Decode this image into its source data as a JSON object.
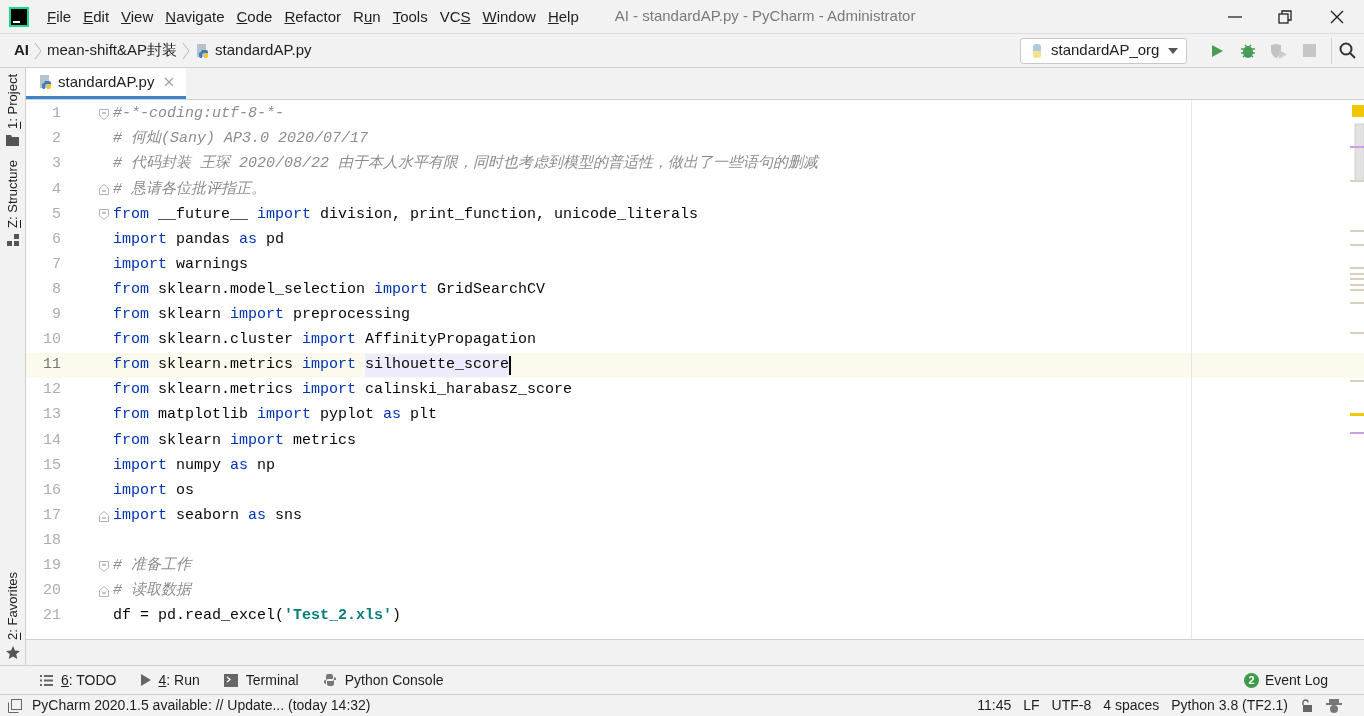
{
  "window": {
    "title": "AI - standardAP.py - PyCharm - Administrator"
  },
  "menu": [
    {
      "key": "F",
      "after": "ile"
    },
    {
      "key": "E",
      "after": "dit"
    },
    {
      "key": "V",
      "after": "iew"
    },
    {
      "key": "N",
      "after": "avigate"
    },
    {
      "key": "C",
      "after": "ode"
    },
    {
      "key": "R",
      "after": "efactor"
    },
    {
      "before": "R",
      "key": "u",
      "after": "n"
    },
    {
      "key": "T",
      "after": "ools"
    },
    {
      "before": "VC",
      "key": "S"
    },
    {
      "key": "W",
      "after": "indow"
    },
    {
      "key": "H",
      "after": "elp"
    }
  ],
  "breadcrumbs": [
    {
      "label": "AI",
      "kind": "project"
    },
    {
      "label": "mean-shift&AP封装",
      "kind": "folder"
    },
    {
      "label": "standardAP.py",
      "kind": "file"
    }
  ],
  "run_config": {
    "label": "standardAP_org"
  },
  "toolbar": [
    {
      "kind": "run",
      "disabled": false
    },
    {
      "kind": "debug",
      "disabled": false
    },
    {
      "kind": "coverage",
      "disabled": true
    },
    {
      "kind": "stop",
      "disabled": true
    },
    {
      "kind": "search",
      "disabled": false
    }
  ],
  "left_tools": [
    {
      "key": "1",
      "after": ": Project",
      "kind": "project"
    },
    {
      "key": "Z",
      "after": ": Structure",
      "kind": "structure"
    },
    {
      "key": "2",
      "after": ": Favorites",
      "kind": "favorites"
    }
  ],
  "tabs": [
    {
      "label": "standardAP.py",
      "selected": true
    }
  ],
  "code_lines": [
    {
      "number": "1",
      "fold_open": true,
      "current": false,
      "segments": [
        {
          "kind": "comment",
          "text": "#-*-coding:utf-8-*-"
        }
      ]
    },
    {
      "number": "2",
      "current": false,
      "segments": [
        {
          "kind": "comment",
          "text": "# 何灿(Sany) AP3.0 2020/07/17"
        }
      ]
    },
    {
      "number": "3",
      "current": false,
      "segments": [
        {
          "kind": "comment",
          "text": "# 代码封装 王琛 2020/08/22 由于本人水平有限，同时也考虑到模型的普适性，做出了一些语句的删减"
        }
      ]
    },
    {
      "number": "4",
      "fold_close": true,
      "current": false,
      "segments": [
        {
          "kind": "comment",
          "text": "# 恳请各位批评指正。"
        }
      ]
    },
    {
      "number": "5",
      "fold_open": true,
      "current": false,
      "segments": [
        {
          "kind": "keyword",
          "text": "from"
        },
        {
          "kind": "text",
          "text": " __future__ "
        },
        {
          "kind": "keyword",
          "text": "import"
        },
        {
          "kind": "text",
          "text": " division, print_function, unicode_literals"
        }
      ]
    },
    {
      "number": "6",
      "current": false,
      "segments": [
        {
          "kind": "keyword",
          "text": "import"
        },
        {
          "kind": "text",
          "text": " pandas "
        },
        {
          "kind": "keyword",
          "text": "as"
        },
        {
          "kind": "text",
          "text": " pd"
        }
      ]
    },
    {
      "number": "7",
      "current": false,
      "segments": [
        {
          "kind": "keyword",
          "text": "import"
        },
        {
          "kind": "text",
          "text": " warnings"
        }
      ]
    },
    {
      "number": "8",
      "current": false,
      "segments": [
        {
          "kind": "keyword",
          "text": "from"
        },
        {
          "kind": "text",
          "text": " sklearn.model_selection "
        },
        {
          "kind": "keyword",
          "text": "import"
        },
        {
          "kind": "text",
          "text": " GridSearchCV"
        }
      ]
    },
    {
      "number": "9",
      "current": false,
      "segments": [
        {
          "kind": "keyword",
          "text": "from"
        },
        {
          "kind": "text",
          "text": " sklearn "
        },
        {
          "kind": "keyword",
          "text": "import"
        },
        {
          "kind": "text",
          "text": " preprocessing"
        }
      ]
    },
    {
      "number": "10",
      "current": false,
      "segments": [
        {
          "kind": "keyword",
          "text": "from"
        },
        {
          "kind": "text",
          "text": " sklearn.cluster "
        },
        {
          "kind": "keyword",
          "text": "import"
        },
        {
          "kind": "text",
          "text": " AffinityPropagation"
        }
      ]
    },
    {
      "number": "11",
      "current": true,
      "segments": [
        {
          "kind": "keyword",
          "text": "from"
        },
        {
          "kind": "text",
          "text": " sklearn.metrics "
        },
        {
          "kind": "keyword",
          "text": "import "
        },
        {
          "kind": "highlight",
          "text": "silhouette_score"
        }
      ]
    },
    {
      "number": "12",
      "current": false,
      "segments": [
        {
          "kind": "keyword",
          "text": "from"
        },
        {
          "kind": "text",
          "text": " sklearn.metrics "
        },
        {
          "kind": "keyword",
          "text": "import"
        },
        {
          "kind": "text",
          "text": " calinski_harabasz_score"
        }
      ]
    },
    {
      "number": "13",
      "current": false,
      "segments": [
        {
          "kind": "keyword",
          "text": "from"
        },
        {
          "kind": "text",
          "text": " matplotlib "
        },
        {
          "kind": "keyword",
          "text": "import"
        },
        {
          "kind": "text",
          "text": " pyplot "
        },
        {
          "kind": "keyword",
          "text": "as"
        },
        {
          "kind": "text",
          "text": " plt"
        }
      ]
    },
    {
      "number": "14",
      "current": false,
      "segments": [
        {
          "kind": "keyword",
          "text": "from"
        },
        {
          "kind": "text",
          "text": " sklearn "
        },
        {
          "kind": "keyword",
          "text": "import"
        },
        {
          "kind": "text",
          "text": " metrics"
        }
      ]
    },
    {
      "number": "15",
      "current": false,
      "segments": [
        {
          "kind": "keyword",
          "text": "import"
        },
        {
          "kind": "text",
          "text": " numpy "
        },
        {
          "kind": "keyword",
          "text": "as"
        },
        {
          "kind": "text",
          "text": " np"
        }
      ]
    },
    {
      "number": "16",
      "current": false,
      "segments": [
        {
          "kind": "keyword",
          "text": "import"
        },
        {
          "kind": "text",
          "text": " os"
        }
      ]
    },
    {
      "number": "17",
      "fold_close": true,
      "current": false,
      "segments": [
        {
          "kind": "keyword",
          "text": "import"
        },
        {
          "kind": "text",
          "text": " seaborn "
        },
        {
          "kind": "keyword",
          "text": "as"
        },
        {
          "kind": "text",
          "text": " sns"
        }
      ]
    },
    {
      "number": "18",
      "current": false
    },
    {
      "number": "19",
      "fold_open": true,
      "current": false,
      "segments": [
        {
          "kind": "comment",
          "text": "# 准备工作"
        }
      ]
    },
    {
      "number": "20",
      "fold_close": true,
      "current": false,
      "segments": [
        {
          "kind": "comment",
          "text": "# 读取数据"
        }
      ]
    },
    {
      "number": "21",
      "current": false,
      "segments": [
        {
          "kind": "text",
          "text": "df = pd.read_excel("
        },
        {
          "kind": "string",
          "text": "'Test_2.xls'"
        },
        {
          "kind": "text",
          "text": ")"
        }
      ]
    }
  ],
  "bottom_tools": [
    {
      "key": "6",
      "after": ": TODO",
      "kind": "todo"
    },
    {
      "key": "4",
      "after": ": Run",
      "kind": "run"
    },
    {
      "after": "Terminal",
      "kind": "terminal"
    },
    {
      "after": "Python Console",
      "kind": "console"
    }
  ],
  "event_log": {
    "count": "2",
    "label": "Event Log"
  },
  "status_bar": {
    "message": "PyCharm 2020.1.5 available: // Update... (today 14:32)",
    "items": [
      "11:45",
      "LF",
      "UTF-8",
      "4 spaces",
      "Python 3.8 (TF2.1)"
    ]
  }
}
